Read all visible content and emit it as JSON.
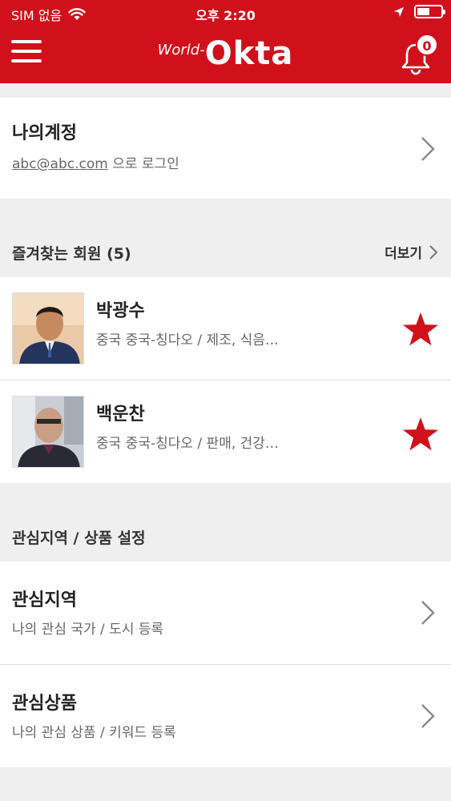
{
  "status_bar": {
    "carrier": "SIM 없음",
    "time": "오후 2:20",
    "battery_level": 0.55
  },
  "header": {
    "logo_small": "World-",
    "logo_big": "Okta",
    "notification_count": "0",
    "accent_color": "#d0111b"
  },
  "account": {
    "title": "나의계정",
    "email": "abc@abc.com",
    "login_suffix": "으로 로그인"
  },
  "favorites": {
    "header": "즐겨찾는 회원 (5)",
    "more": "더보기",
    "members": [
      {
        "name": "박광수",
        "info": "중국 중국-칭다오 / 제조, 식음…"
      },
      {
        "name": "백운찬",
        "info": "중국 중국-칭다오 / 판매, 건강…"
      }
    ]
  },
  "interest_settings": {
    "header": "관심지역 / 상품 설정",
    "items": [
      {
        "title": "관심지역",
        "sub": "나의 관심 국가 / 도시 등록"
      },
      {
        "title": "관심상품",
        "sub": "나의 관심 상품 / 키워드 등록"
      }
    ]
  },
  "icons": [
    "wifi-icon",
    "location-arrow-icon",
    "battery-icon",
    "menu-icon",
    "bell-icon",
    "chevron-right-icon",
    "star-icon"
  ]
}
